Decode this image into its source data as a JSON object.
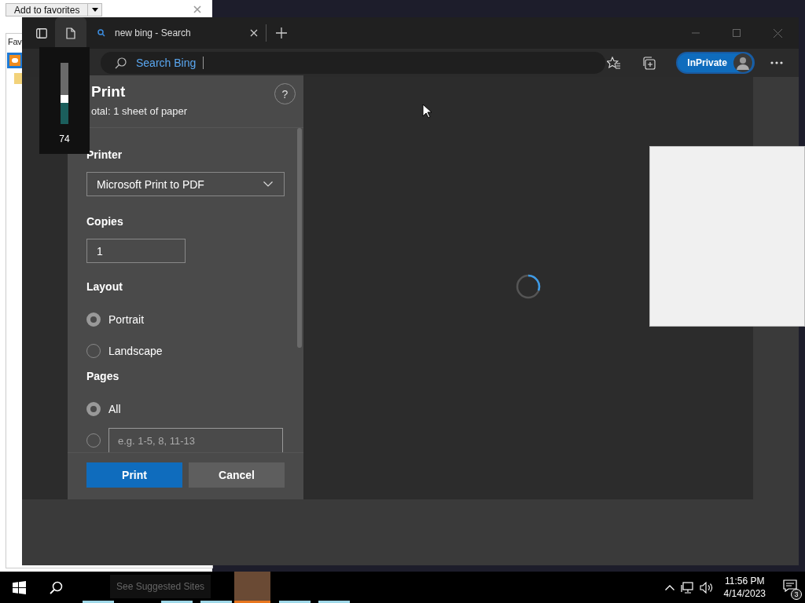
{
  "background_window": {
    "button": "Add to favorites",
    "heading": "Fav"
  },
  "browser": {
    "tabs": [
      {
        "kind": "page",
        "selected": true
      },
      {
        "kind": "search",
        "label": "new bing - Search",
        "selected": false
      }
    ],
    "address_placeholder": "Search Bing",
    "inprivate": "InPrivate"
  },
  "print_dialog": {
    "title": "Print",
    "subtitle": "otal: 1 sheet of paper",
    "help": "?",
    "printer_label": "Printer",
    "printer": "Microsoft Print to PDF",
    "copies_label": "Copies",
    "copies": "1",
    "layout_label": "Layout",
    "layout_options": [
      {
        "label": "Portrait",
        "selected": true
      },
      {
        "label": "Landscape",
        "selected": false
      }
    ],
    "pages_label": "Pages",
    "pages_options": [
      {
        "kind": "all",
        "label": "All",
        "selected": true
      },
      {
        "kind": "range",
        "placeholder": "e.g. 1-5, 8, 11-13",
        "selected": false
      }
    ],
    "buttons": [
      {
        "kind": "primary",
        "label": "Print"
      },
      {
        "kind": "secondary",
        "label": "Cancel"
      }
    ]
  },
  "volume_overlay": {
    "level": 0.47,
    "reading": "74"
  },
  "taskbar": {
    "tooltip": "See Suggested Sites",
    "apps": [
      {
        "color": "#9fd8e8",
        "selected": false
      },
      {
        "color": "#9fd8e8",
        "selected": false
      },
      {
        "color": "#9fd8e8",
        "selected": false
      },
      {
        "color": "#e8761e",
        "selected": true
      },
      {
        "color": "#9fd8e8",
        "selected": false
      },
      {
        "color": "#9fd8e8",
        "selected": false
      }
    ],
    "clock_time": "11:56 PM",
    "clock_date": "4/14/2023",
    "notifications": "3"
  }
}
